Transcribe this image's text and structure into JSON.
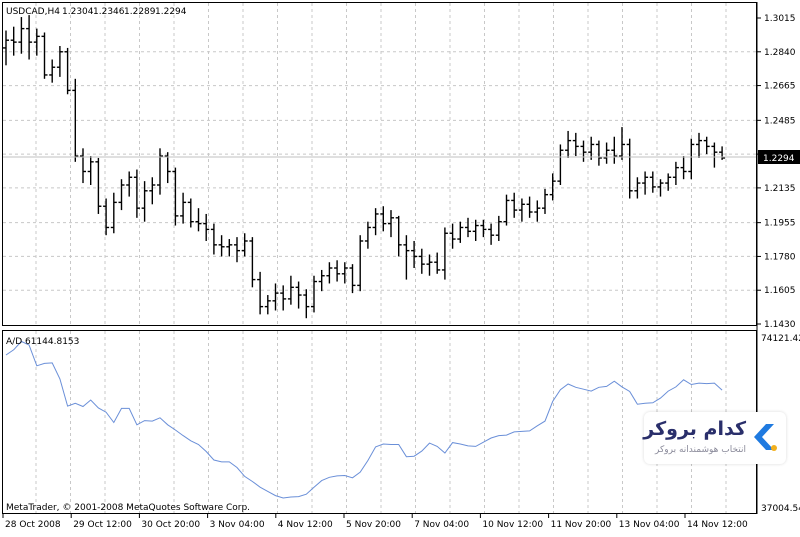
{
  "window": {
    "symbol_header": "USDCAD,H4",
    "ohlc": [
      "1.2304",
      "1.2346",
      "1.2289",
      "1.2294"
    ]
  },
  "price_axis": {
    "ticks": [
      "1.3015",
      "1.2840",
      "1.2665",
      "1.2485",
      "1.2310",
      "1.2135",
      "1.1955",
      "1.1780",
      "1.1605",
      "1.1430"
    ],
    "current_price": "1.2294"
  },
  "indicator": {
    "label": "A/D 61144.8153",
    "scale_top": "74121.42",
    "scale_bottom": "37004.54",
    "line_color": "#6a8fd8"
  },
  "time_axis": {
    "labels": [
      "28 Oct 2008",
      "29 Oct 12:00",
      "30 Oct 20:00",
      "3 Nov 04:00",
      "4 Nov 12:00",
      "5 Nov 20:00",
      "7 Nov 04:00",
      "10 Nov 12:00",
      "11 Nov 20:00",
      "13 Nov 04:00",
      "14 Nov 12:00"
    ]
  },
  "copyright": "MetaTrader, © 2001-2008 MetaQuotes Software Corp.",
  "watermark": {
    "title": "کدام بروکر",
    "subtitle": "انتخاب هوشمندانه بروکر",
    "icon": "chevron-left-icon",
    "accent": "#1f7ae0"
  },
  "chart_data": [
    {
      "type": "ohlc",
      "title": "USDCAD,H4",
      "ylim": [
        1.143,
        1.3015
      ],
      "bar_color": "#000000",
      "grid": true,
      "bars": [
        [
          1.286,
          1.295,
          1.277,
          1.29
        ],
        [
          1.29,
          1.297,
          1.282,
          1.289
        ],
        [
          1.289,
          1.302,
          1.283,
          1.296
        ],
        [
          1.296,
          1.303,
          1.28,
          1.289
        ],
        [
          1.289,
          1.296,
          1.282,
          1.292
        ],
        [
          1.292,
          1.294,
          1.27,
          1.272
        ],
        [
          1.272,
          1.28,
          1.268,
          1.276
        ],
        [
          1.276,
          1.287,
          1.271,
          1.284
        ],
        [
          1.284,
          1.286,
          1.262,
          1.264
        ],
        [
          1.264,
          1.27,
          1.227,
          1.23
        ],
        [
          1.23,
          1.234,
          1.216,
          1.222
        ],
        [
          1.222,
          1.23,
          1.215,
          1.227
        ],
        [
          1.227,
          1.229,
          1.2,
          1.204
        ],
        [
          1.204,
          1.208,
          1.189,
          1.193
        ],
        [
          1.193,
          1.211,
          1.19,
          1.206
        ],
        [
          1.206,
          1.218,
          1.202,
          1.215
        ],
        [
          1.215,
          1.222,
          1.209,
          1.219
        ],
        [
          1.219,
          1.223,
          1.198,
          1.203
        ],
        [
          1.203,
          1.217,
          1.196,
          1.212
        ],
        [
          1.212,
          1.219,
          1.205,
          1.215
        ],
        [
          1.215,
          1.234,
          1.21,
          1.23
        ],
        [
          1.23,
          1.232,
          1.216,
          1.222
        ],
        [
          1.222,
          1.224,
          1.194,
          1.199
        ],
        [
          1.199,
          1.211,
          1.195,
          1.206
        ],
        [
          1.206,
          1.208,
          1.193,
          1.196
        ],
        [
          1.196,
          1.203,
          1.191,
          1.195
        ],
        [
          1.195,
          1.2,
          1.186,
          1.192
        ],
        [
          1.192,
          1.195,
          1.179,
          1.184
        ],
        [
          1.184,
          1.189,
          1.178,
          1.183
        ],
        [
          1.183,
          1.187,
          1.178,
          1.184
        ],
        [
          1.184,
          1.188,
          1.175,
          1.181
        ],
        [
          1.181,
          1.19,
          1.178,
          1.186
        ],
        [
          1.186,
          1.188,
          1.162,
          1.166
        ],
        [
          1.166,
          1.17,
          1.148,
          1.152
        ],
        [
          1.152,
          1.158,
          1.148,
          1.155
        ],
        [
          1.155,
          1.164,
          1.15,
          1.159
        ],
        [
          1.159,
          1.163,
          1.15,
          1.156
        ],
        [
          1.156,
          1.168,
          1.153,
          1.162
        ],
        [
          1.162,
          1.165,
          1.151,
          1.158
        ],
        [
          1.158,
          1.161,
          1.146,
          1.152
        ],
        [
          1.152,
          1.168,
          1.149,
          1.165
        ],
        [
          1.165,
          1.171,
          1.16,
          1.168
        ],
        [
          1.168,
          1.175,
          1.164,
          1.172
        ],
        [
          1.172,
          1.176,
          1.165,
          1.169
        ],
        [
          1.169,
          1.175,
          1.164,
          1.172
        ],
        [
          1.172,
          1.174,
          1.159,
          1.163
        ],
        [
          1.163,
          1.189,
          1.16,
          1.186
        ],
        [
          1.186,
          1.196,
          1.182,
          1.193
        ],
        [
          1.193,
          1.203,
          1.189,
          1.2
        ],
        [
          1.2,
          1.204,
          1.191,
          1.195
        ],
        [
          1.195,
          1.202,
          1.188,
          1.198
        ],
        [
          1.198,
          1.199,
          1.178,
          1.184
        ],
        [
          1.184,
          1.189,
          1.166,
          1.181
        ],
        [
          1.181,
          1.186,
          1.172,
          1.178
        ],
        [
          1.178,
          1.182,
          1.169,
          1.174
        ],
        [
          1.174,
          1.179,
          1.168,
          1.175
        ],
        [
          1.175,
          1.18,
          1.169,
          1.171
        ],
        [
          1.171,
          1.193,
          1.166,
          1.19
        ],
        [
          1.19,
          1.195,
          1.182,
          1.187
        ],
        [
          1.187,
          1.196,
          1.185,
          1.193
        ],
        [
          1.193,
          1.198,
          1.188,
          1.191
        ],
        [
          1.191,
          1.197,
          1.186,
          1.194
        ],
        [
          1.194,
          1.197,
          1.188,
          1.192
        ],
        [
          1.192,
          1.195,
          1.184,
          1.189
        ],
        [
          1.189,
          1.199,
          1.186,
          1.196
        ],
        [
          1.196,
          1.21,
          1.194,
          1.207
        ],
        [
          1.207,
          1.211,
          1.198,
          1.202
        ],
        [
          1.202,
          1.208,
          1.196,
          1.205
        ],
        [
          1.205,
          1.209,
          1.198,
          1.201
        ],
        [
          1.201,
          1.207,
          1.196,
          1.203
        ],
        [
          1.203,
          1.213,
          1.2,
          1.21
        ],
        [
          1.21,
          1.221,
          1.207,
          1.217
        ],
        [
          1.217,
          1.236,
          1.215,
          1.233
        ],
        [
          1.233,
          1.243,
          1.229,
          1.238
        ],
        [
          1.238,
          1.242,
          1.23,
          1.235
        ],
        [
          1.235,
          1.238,
          1.227,
          1.232
        ],
        [
          1.232,
          1.24,
          1.228,
          1.236
        ],
        [
          1.236,
          1.238,
          1.225,
          1.229
        ],
        [
          1.229,
          1.237,
          1.226,
          1.233
        ],
        [
          1.233,
          1.24,
          1.226,
          1.23
        ],
        [
          1.23,
          1.245,
          1.228,
          1.236
        ],
        [
          1.236,
          1.239,
          1.208,
          1.212
        ],
        [
          1.212,
          1.219,
          1.208,
          1.216
        ],
        [
          1.216,
          1.222,
          1.21,
          1.219
        ],
        [
          1.219,
          1.222,
          1.211,
          1.214
        ],
        [
          1.214,
          1.218,
          1.209,
          1.216
        ],
        [
          1.216,
          1.221,
          1.212,
          1.219
        ],
        [
          1.219,
          1.227,
          1.215,
          1.224
        ],
        [
          1.224,
          1.23,
          1.218,
          1.222
        ],
        [
          1.222,
          1.239,
          1.218,
          1.236
        ],
        [
          1.236,
          1.242,
          1.229,
          1.238
        ],
        [
          1.238,
          1.24,
          1.231,
          1.235
        ],
        [
          1.235,
          1.237,
          1.224,
          1.232
        ],
        [
          1.232,
          1.235,
          1.228,
          1.229
        ]
      ]
    },
    {
      "type": "line",
      "title": "A/D",
      "series": [
        {
          "name": "A/D",
          "ylim": [
            37004.54,
            74121.42
          ],
          "values": [
            70500,
            71600,
            73400,
            72600,
            68200,
            68700,
            68800,
            65400,
            59600,
            60200,
            59500,
            60900,
            59200,
            58300,
            56100,
            59100,
            59100,
            55600,
            56500,
            56400,
            57100,
            55600,
            54500,
            53300,
            52200,
            51400,
            49900,
            48100,
            47700,
            47700,
            46500,
            44600,
            43500,
            42300,
            41400,
            40500,
            40000,
            40200,
            40300,
            40800,
            42300,
            43700,
            44400,
            44700,
            44800,
            44300,
            45500,
            48000,
            50900,
            51500,
            51400,
            51400,
            48800,
            48900,
            50000,
            51700,
            51000,
            49600,
            51800,
            51500,
            51100,
            51000,
            51900,
            52800,
            53300,
            53400,
            54100,
            54200,
            54300,
            55400,
            56400,
            60600,
            63100,
            64300,
            63600,
            63200,
            62800,
            63600,
            63800,
            64900,
            63700,
            62700,
            60000,
            60200,
            60300,
            61300,
            62800,
            63700,
            65200,
            64200,
            64500,
            64400,
            64500,
            63000
          ]
        }
      ]
    }
  ]
}
